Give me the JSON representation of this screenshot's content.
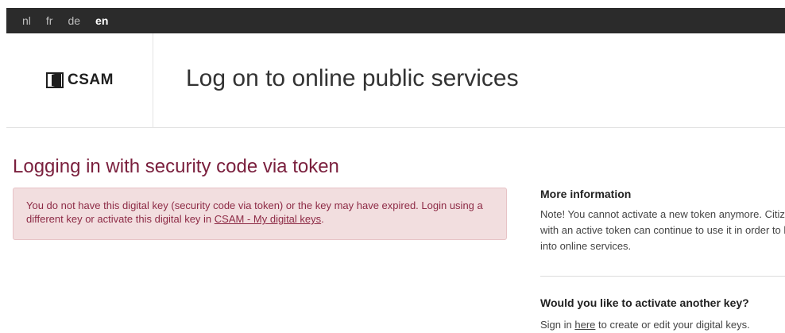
{
  "languages": [
    {
      "label": "nl",
      "active": false
    },
    {
      "label": "fr",
      "active": false
    },
    {
      "label": "de",
      "active": false
    },
    {
      "label": "en",
      "active": true
    }
  ],
  "header": {
    "logo_text": "CSAM",
    "title": "Log on to online public services"
  },
  "main": {
    "heading": "Logging in with security code via token",
    "alert": {
      "text_before": "You do not have this digital key (security code via token) or the key may have expired. Login using a different key or activate this digital key in ",
      "link_text": "CSAM - My digital keys",
      "text_after": "."
    }
  },
  "sidebar": {
    "more_info": {
      "title": "More information",
      "text": "Note! You cannot activate a new token anymore. Citizens with an active token can continue to use it in order to log into online services."
    },
    "activate": {
      "title": "Would you like to activate another key?",
      "text_before": "Sign in ",
      "link_text": "here",
      "text_after": " to create or edit your digital keys."
    }
  },
  "colors": {
    "lang_bar": "#2b2b2b",
    "heading": "#7a1f3d",
    "alert_bg": "#f2dedf",
    "alert_text": "#8d2a45"
  }
}
